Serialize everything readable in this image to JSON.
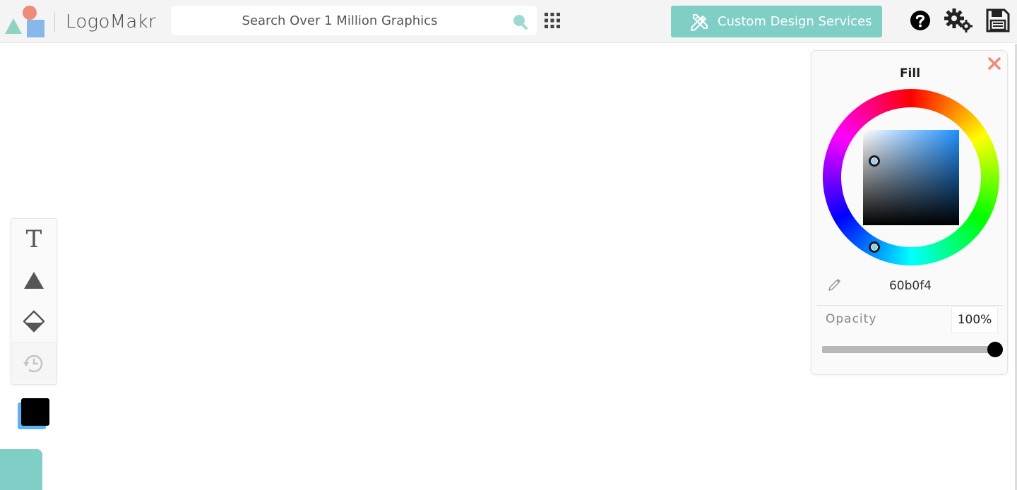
{
  "header": {
    "logo_text": "LogoMakr",
    "search_placeholder": "Search Over 1 Million Graphics",
    "cta_label": "Custom Design Services",
    "icons": [
      "logo-shapes-icon",
      "search-icon",
      "grid-icon",
      "pencil-ruler-icon",
      "help-icon",
      "settings-icon",
      "save-icon"
    ]
  },
  "toolbar": {
    "tools": [
      {
        "name": "text-tool",
        "glyph": "T"
      },
      {
        "name": "shape-tool",
        "icon": "triangle-icon"
      },
      {
        "name": "bucket-tool",
        "icon": "paint-bucket-icon"
      },
      {
        "name": "history-tool",
        "icon": "history-icon"
      }
    ],
    "foreground_color": "#000000",
    "background_color": "#60b0f4"
  },
  "fill_panel": {
    "title": "Fill",
    "hex": "60b0f4",
    "opacity_label": "Opacity",
    "opacity_value": "100%",
    "opacity_fraction": 1.0
  },
  "colors": {
    "accent": "#80cfc7",
    "close": "#f28a7d",
    "selected_fill": "#60b0f4"
  }
}
